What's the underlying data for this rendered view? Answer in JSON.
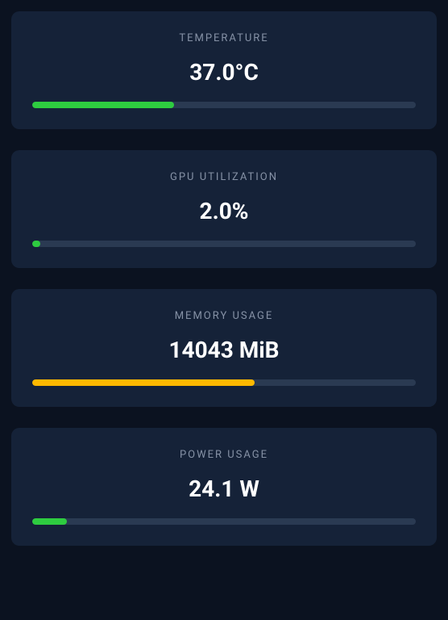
{
  "cards": {
    "temperature": {
      "title": "TEMPERATURE",
      "value": "37.0°C",
      "percent": 37,
      "color": "green"
    },
    "gpu_util": {
      "title": "GPU UTILIZATION",
      "value": "2.0%",
      "percent": 2,
      "color": "green"
    },
    "memory": {
      "title": "MEMORY USAGE",
      "value": "14043 MiB",
      "percent": 58,
      "color": "yellow"
    },
    "power": {
      "title": "POWER USAGE",
      "value": "24.1 W",
      "percent": 9,
      "color": "green"
    }
  }
}
